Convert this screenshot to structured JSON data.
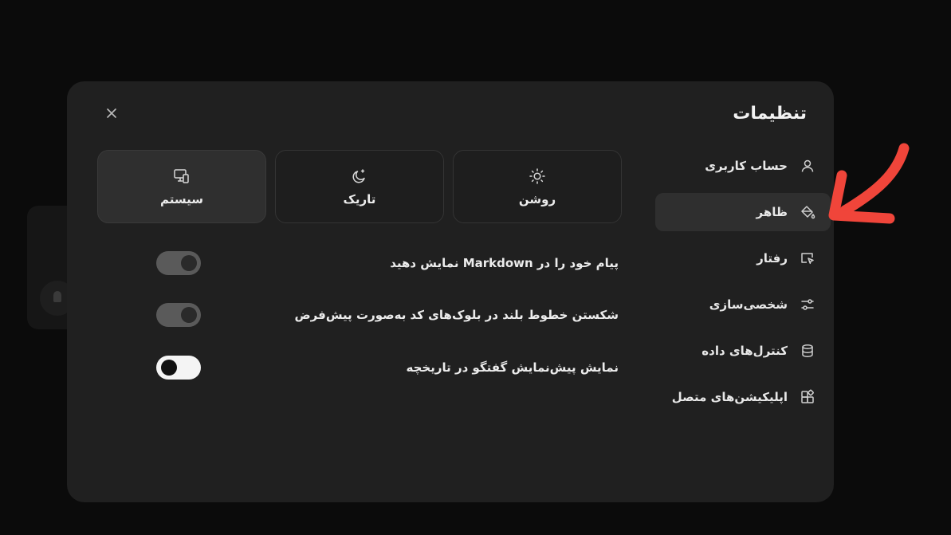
{
  "dialog": {
    "title": "تنظیمات"
  },
  "sidebar": {
    "items": [
      {
        "label": "حساب کاربری",
        "icon": "user-icon"
      },
      {
        "label": "ظاهر",
        "icon": "paint-bucket-icon",
        "active": true
      },
      {
        "label": "رفتار",
        "icon": "cursor-window-icon"
      },
      {
        "label": "شخصی‌سازی",
        "icon": "sliders-icon"
      },
      {
        "label": "کنترل‌های داده",
        "icon": "database-icon"
      },
      {
        "label": "اپلیکیشن‌های متصل",
        "icon": "apps-grid-icon"
      }
    ]
  },
  "theme": {
    "options": [
      {
        "label": "روشن",
        "icon": "sun-icon"
      },
      {
        "label": "تاریک",
        "icon": "moon-icon"
      },
      {
        "label": "سیستم",
        "icon": "devices-icon",
        "selected": true
      }
    ]
  },
  "settings": [
    {
      "label": "پیام خود را در Markdown نمایش دهید",
      "state": "on"
    },
    {
      "label": "شکستن خطوط بلند در بلوک‌های کد به‌صورت پیش‌فرض",
      "state": "on"
    },
    {
      "label": "نمایش پیش‌نمایش گفتگو در تاریخچه",
      "state": "off"
    }
  ],
  "colors": {
    "background": "#0b0b0b",
    "modal": "#202020",
    "active_item": "#2f2f2f",
    "annotation_arrow": "#f0453a"
  }
}
